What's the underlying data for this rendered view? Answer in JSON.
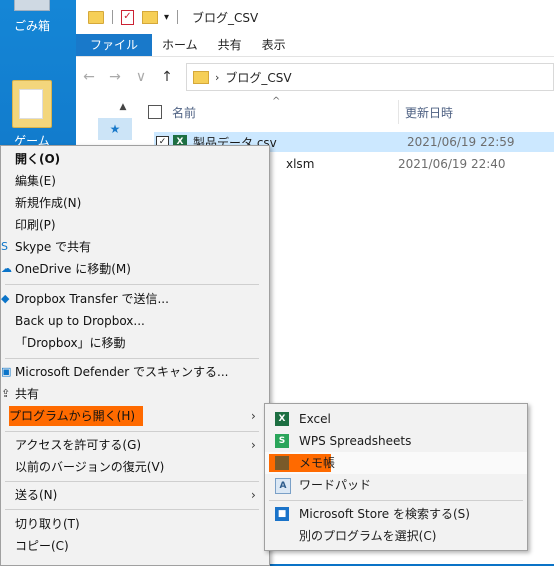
{
  "desktop": {
    "recycle_label": "ごみ箱",
    "folder_label": "ゲーム"
  },
  "explorer": {
    "title": "ブログ_CSV",
    "ribbon_tabs": [
      "ファイル",
      "ホーム",
      "共有",
      "表示"
    ],
    "address": "ブログ_CSV",
    "columns": {
      "name": "名前",
      "date": "更新日時"
    },
    "files": [
      {
        "name": "製品データ.csv",
        "date": "2021/06/19 22:59",
        "selected": true
      },
      {
        "name": "xlsm",
        "date": "2021/06/19 22:40",
        "selected": false
      }
    ]
  },
  "context_menu": {
    "items": [
      {
        "label": "開く(O)",
        "bold": true
      },
      {
        "label": "編集(E)"
      },
      {
        "label": "新規作成(N)"
      },
      {
        "label": "印刷(P)"
      },
      {
        "label": "Skype で共有",
        "icon": "skype-icon"
      },
      {
        "label": "OneDrive に移動(M)",
        "icon": "onedrive-icon"
      },
      {
        "label": "Dropbox Transfer で送信...",
        "icon": "dropbox-icon"
      },
      {
        "label": "Back up to Dropbox..."
      },
      {
        "label": "「Dropbox」に移動"
      },
      {
        "label": "Microsoft Defender でスキャンする...",
        "icon": "defender-icon"
      },
      {
        "label": "共有",
        "icon": "share-icon"
      },
      {
        "label": "プログラムから開く(H)",
        "submenu": true,
        "highlighted": true
      },
      {
        "label": "アクセスを許可する(G)",
        "submenu": true
      },
      {
        "label": "以前のバージョンの復元(V)"
      },
      {
        "label": "送る(N)",
        "submenu": true
      },
      {
        "label": "切り取り(T)"
      },
      {
        "label": "コピー(C)"
      }
    ]
  },
  "open_with_submenu": {
    "items": [
      {
        "label": "Excel",
        "icon": "excel-icon"
      },
      {
        "label": "WPS Spreadsheets",
        "icon": "wps-icon"
      },
      {
        "label": "メモ帳",
        "icon": "notepad-icon",
        "highlighted": true
      },
      {
        "label": "ワードパッド",
        "icon": "wordpad-icon"
      },
      {
        "label": "Microsoft Store を検索する(S)",
        "icon": "store-icon"
      },
      {
        "label": "別のプログラムを選択(C)"
      }
    ]
  },
  "colors": {
    "highlight": "#ff6a00",
    "ribbon_file_tab": "#1979ca",
    "selection": "#cce8ff"
  }
}
